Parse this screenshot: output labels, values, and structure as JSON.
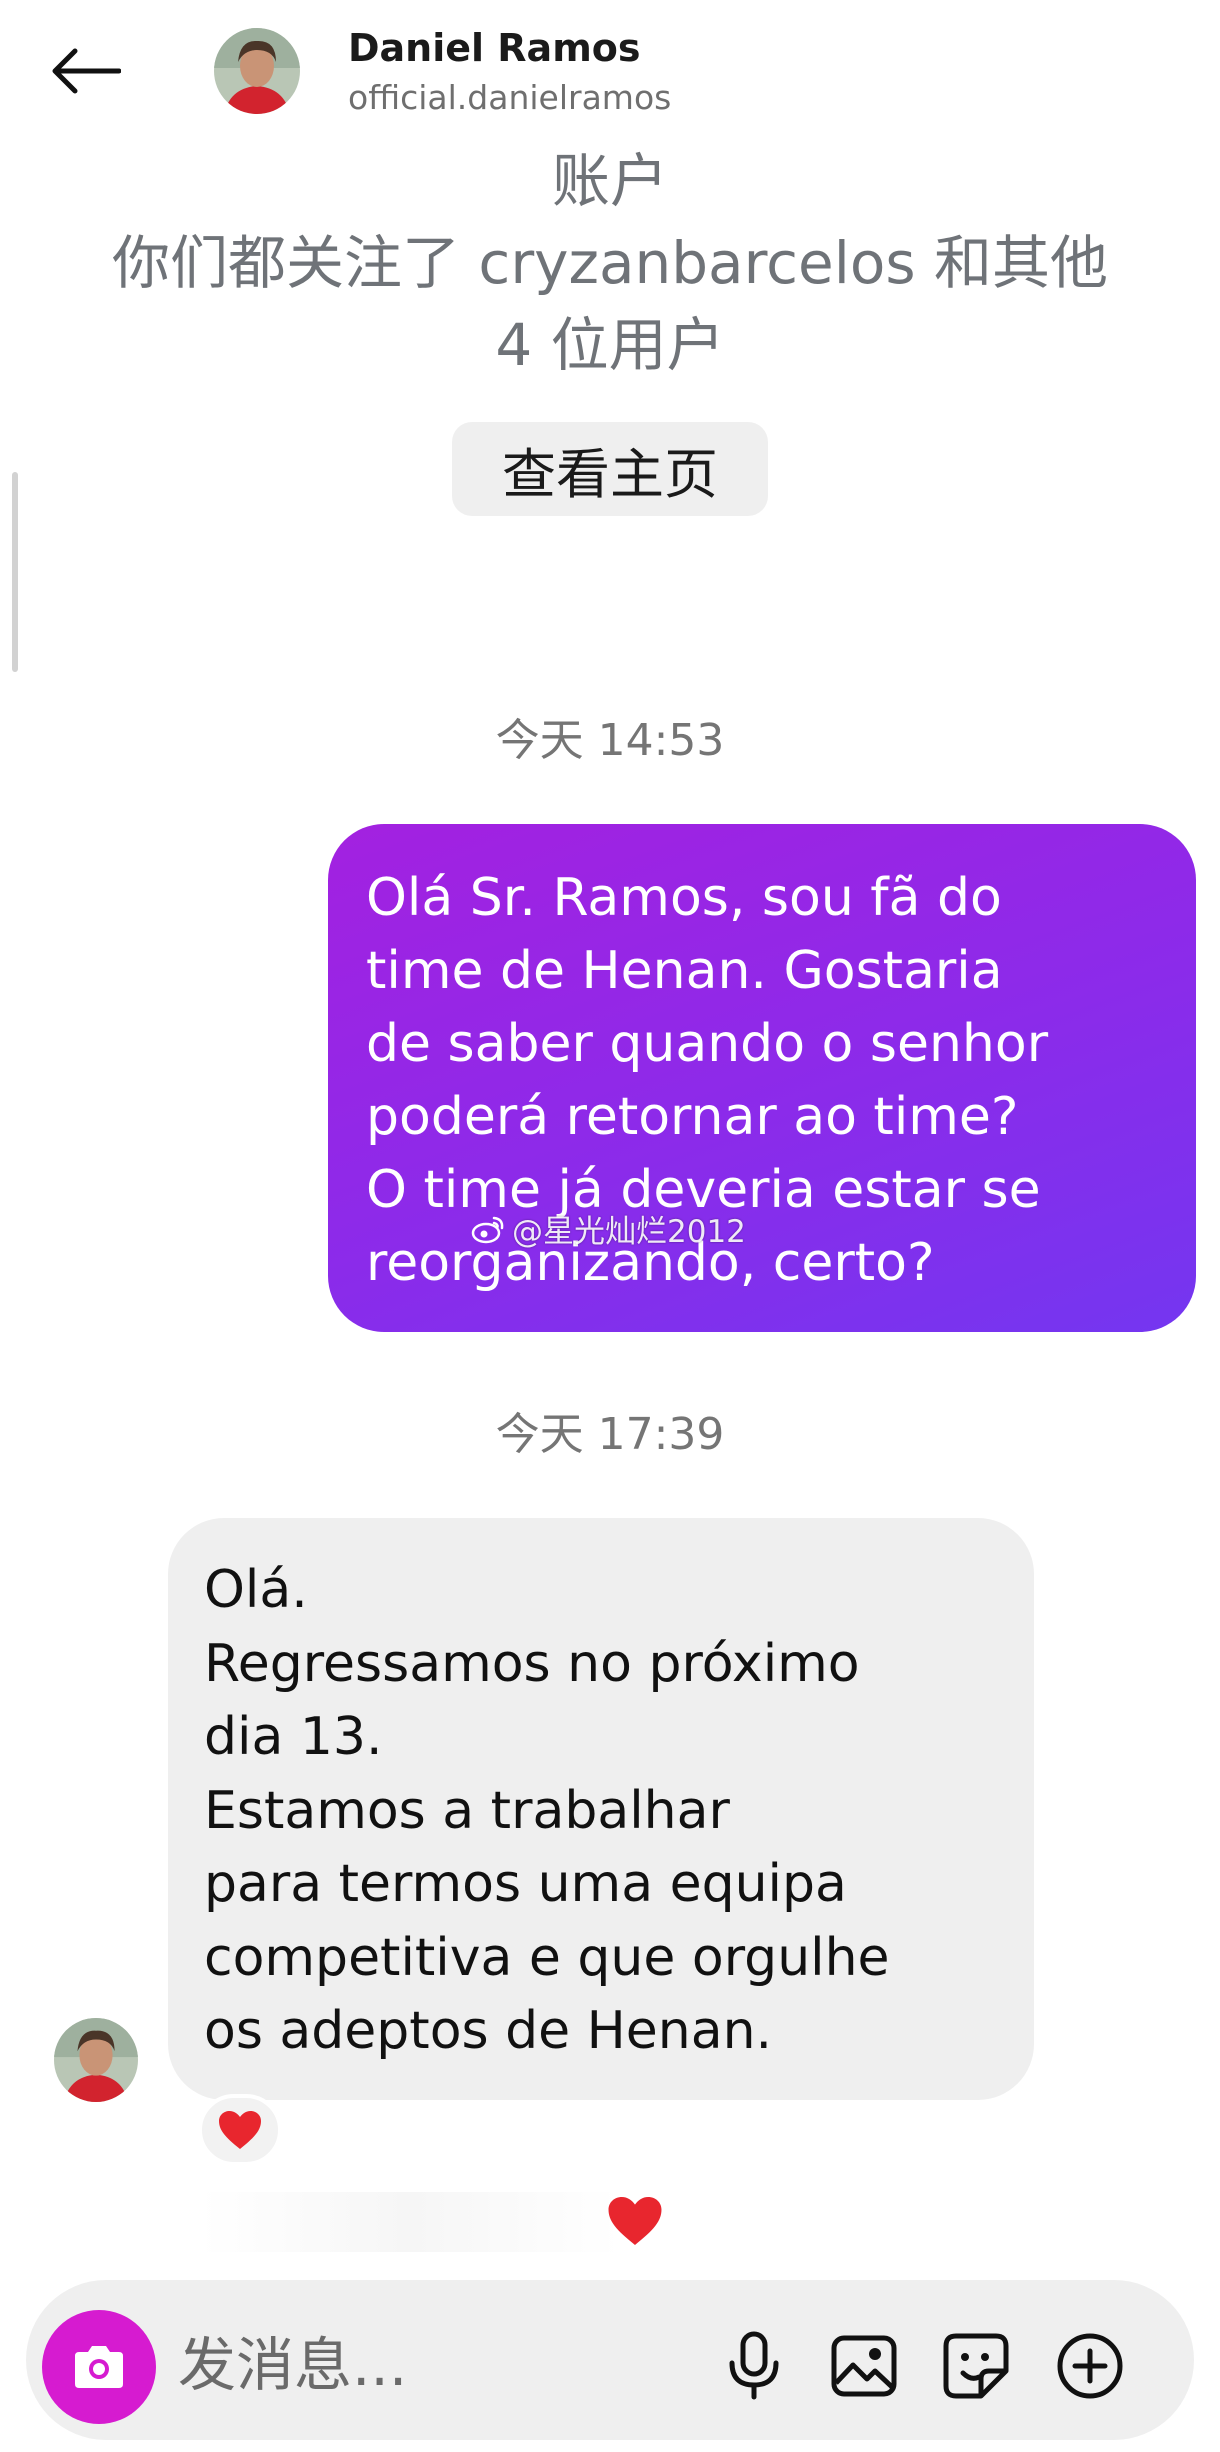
{
  "header": {
    "name": "Daniel Ramos",
    "handle": "official.danielramos"
  },
  "profile": {
    "account_label": "账户",
    "mutual_line1": "你们都关注了 cryzanbarcelos 和其他",
    "mutual_line2": "4 位用户",
    "view_profile_label": "查看主页"
  },
  "messages": {
    "timestamp1": "今天 14:53",
    "sent_text": "Olá Sr. Ramos, sou fã do\ntime de Henan. Gostaria\nde saber quando o senhor\npoderá retornar ao time?\nO time já deveria estar se\nreorganizando, certo?",
    "watermark": "@星光灿烂2012",
    "timestamp2": "今天 17:39",
    "received_text": "Olá.\nRegressamos no próximo\ndia 13.\nEstamos a trabalhar\npara termos uma equipa\ncompetitiva e que orgulhe\nos adeptos de Henan.",
    "reaction": "❤️"
  },
  "composer": {
    "placeholder": "发消息..."
  },
  "colors": {
    "sent_bubble_start": "#a321e0",
    "sent_bubble_end": "#7436f0",
    "received_bubble": "#efefef",
    "camera_button": "#d61bd0",
    "heart": "#e8262e"
  },
  "icons": [
    "back-arrow-icon",
    "camera-icon",
    "microphone-icon",
    "gallery-icon",
    "sticker-icon",
    "plus-icon",
    "heart-icon",
    "weibo-icon"
  ]
}
